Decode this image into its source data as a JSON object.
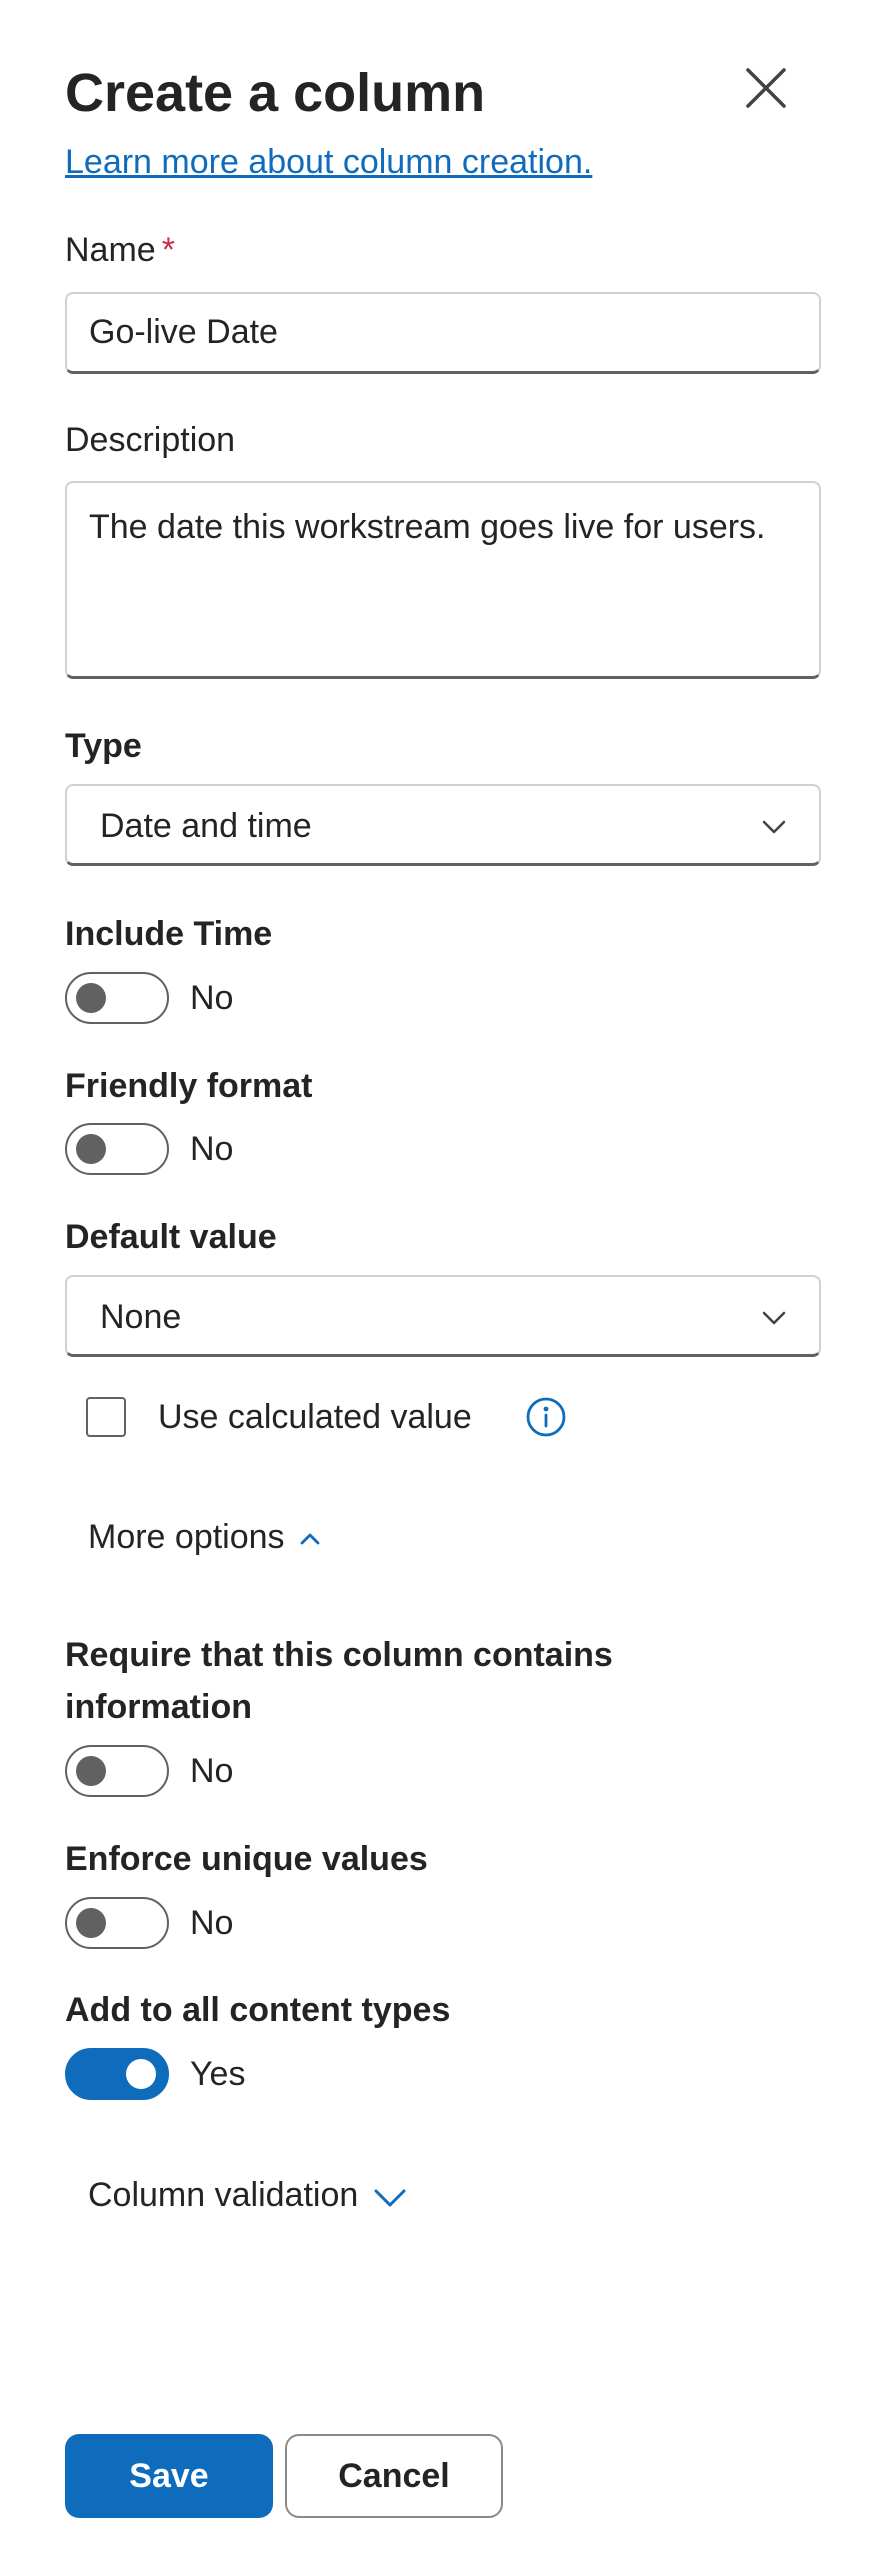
{
  "header": {
    "title": "Create a column",
    "learn_more_link": "Learn more about column creation."
  },
  "name_field": {
    "label": "Name",
    "required_marker": "*",
    "value": "Go-live Date"
  },
  "description_field": {
    "label": "Description",
    "value": "The date this workstream goes live for users."
  },
  "type_field": {
    "label": "Type",
    "selected": "Date and time"
  },
  "include_time": {
    "label": "Include Time",
    "state": "No",
    "on": false
  },
  "friendly_format": {
    "label": "Friendly format",
    "state": "No",
    "on": false
  },
  "default_value": {
    "label": "Default value",
    "selected": "None",
    "use_calculated_label": "Use calculated value",
    "use_calculated_checked": false
  },
  "more_options": {
    "label": "More options",
    "expanded": true
  },
  "require_info": {
    "label_line1": "Require that this column contains",
    "label_line2": "information",
    "state": "No",
    "on": false
  },
  "enforce_unique": {
    "label": "Enforce unique values",
    "state": "No",
    "on": false
  },
  "add_to_content_types": {
    "label": "Add to all content types",
    "state": "Yes",
    "on": true
  },
  "column_validation": {
    "label": "Column validation",
    "expanded": false
  },
  "footer": {
    "save_label": "Save",
    "cancel_label": "Cancel"
  },
  "colors": {
    "accent": "#0f6cbd",
    "required": "#c4314b",
    "toggle_off": "#616161",
    "text": "#242424"
  },
  "icons": {
    "close": "close-icon",
    "dropdown": "chevron-down-icon",
    "info": "info-icon",
    "expand_up": "chevron-up-icon",
    "expand_down": "chevron-down-icon"
  }
}
